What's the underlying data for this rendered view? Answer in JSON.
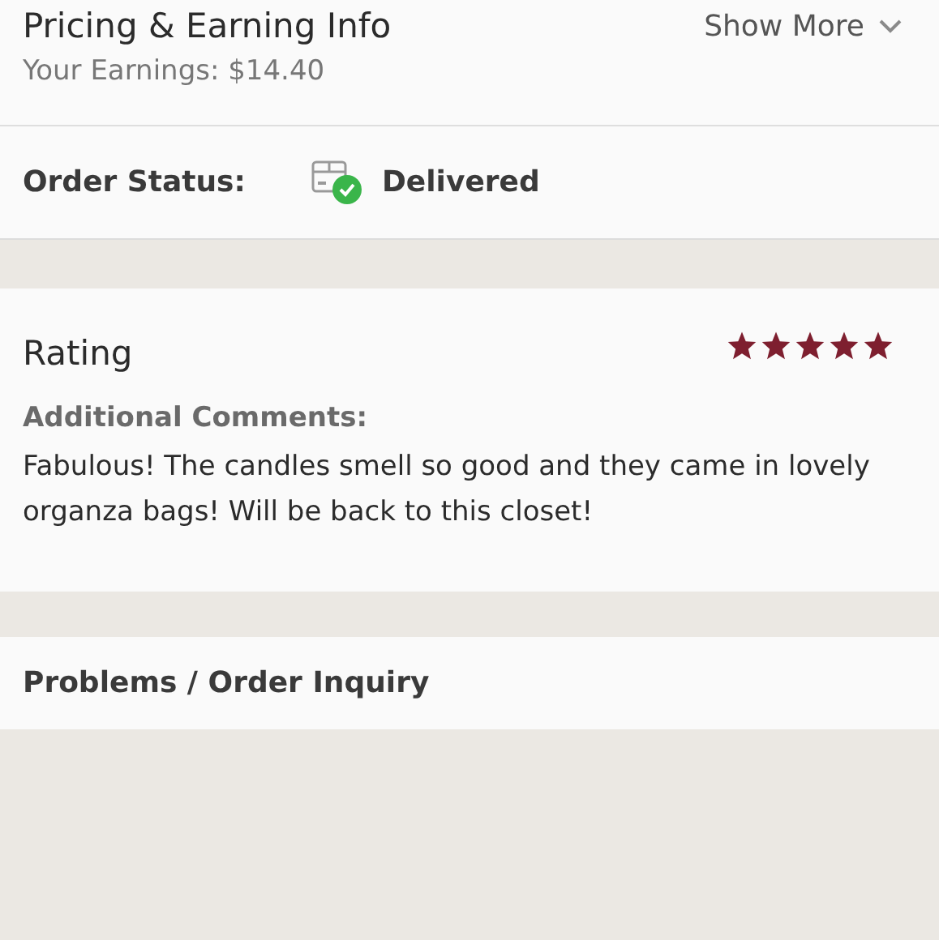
{
  "pricing": {
    "title": "Pricing & Earning Info",
    "show_more": "Show More",
    "earnings": "Your Earnings: $14.40"
  },
  "order_status": {
    "label": "Order Status:",
    "status": "Delivered"
  },
  "rating": {
    "title": "Rating",
    "stars": 5,
    "comments_label": "Additional Comments:",
    "comments": "Fabulous! The candles smell so good and they came in lovely organza bags! Will be back to this closet!"
  },
  "problems": {
    "title": "Problems / Order Inquiry"
  }
}
